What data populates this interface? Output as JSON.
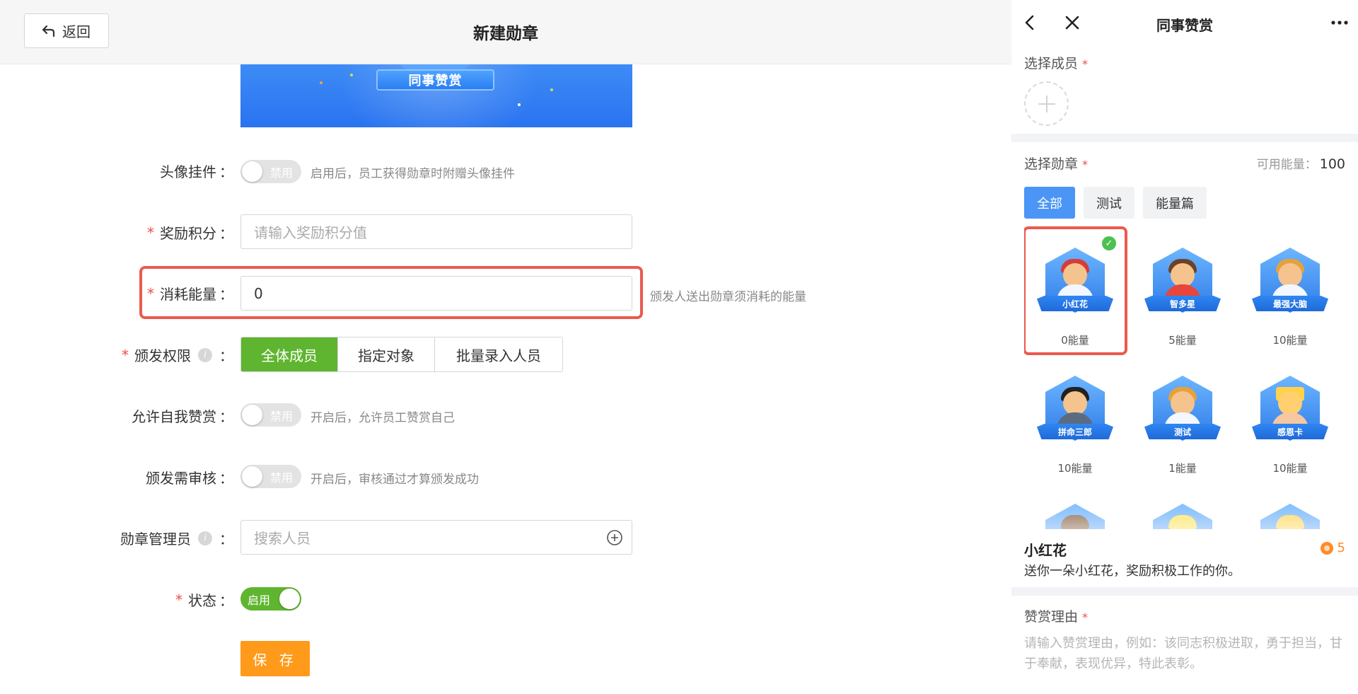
{
  "left": {
    "back_label": "返回",
    "page_title": "新建勋章",
    "banner_label": "同事赞赏",
    "avatar_pendant": {
      "label": "头像挂件",
      "toggle": "禁用",
      "hint": "启用后，员工获得勋章时附赠头像挂件"
    },
    "reward_points": {
      "label": "奖励积分",
      "placeholder": "请输入奖励积分值"
    },
    "energy_cost": {
      "label": "消耗能量",
      "value": "0",
      "hint": "颁发人送出勋章须消耗的能量"
    },
    "issue_permission": {
      "label": "颁发权限",
      "options": [
        "全体成员",
        "指定对象",
        "批量录入人员"
      ],
      "selected": "全体成员"
    },
    "self_praise": {
      "label": "允许自我赞赏",
      "toggle": "禁用",
      "hint": "开启后，允许员工赞赏自己"
    },
    "issue_review": {
      "label": "颁发需审核",
      "toggle": "禁用",
      "hint": "开启后，审核通过才算颁发成功"
    },
    "badge_admin": {
      "label": "勋章管理员",
      "placeholder": "搜索人员"
    },
    "status": {
      "label": "状态",
      "toggle": "启用"
    },
    "save_label": "保 存",
    "colon": "："
  },
  "right": {
    "title": "同事赞赏",
    "select_member_label": "选择成员",
    "select_badge_label": "选择勋章",
    "available_energy_label": "可用能量：",
    "available_energy_value": "100",
    "tabs": [
      "全部",
      "测试",
      "能量篇"
    ],
    "active_tab": "全部",
    "badges": [
      {
        "name": "小红花",
        "cost": "0能量",
        "selected": true
      },
      {
        "name": "智多星",
        "cost": "5能量",
        "selected": false
      },
      {
        "name": "最强大脑",
        "cost": "10能量",
        "selected": false
      },
      {
        "name": "拼命三郎",
        "cost": "10能量",
        "selected": false
      },
      {
        "name": "测试",
        "cost": "1能量",
        "selected": false
      },
      {
        "name": "感恩卡",
        "cost": "10能量",
        "selected": false
      }
    ],
    "selected_badge": {
      "name": "小红花",
      "desc": "送你一朵小红花，奖励积极工作的你。",
      "energy": "5"
    },
    "reason_label": "赞赏理由",
    "reason_placeholder": "请输入赞赏理由，例如：该同志积极进取，勇于担当，甘于奉献，表现优异，特此表彰。",
    "required_mark": "*"
  },
  "colors": {
    "accent_green": "#5fb52f",
    "accent_orange": "#ff9a1a",
    "highlight_red": "#eb5a4e",
    "blue": "#4a95f5"
  }
}
